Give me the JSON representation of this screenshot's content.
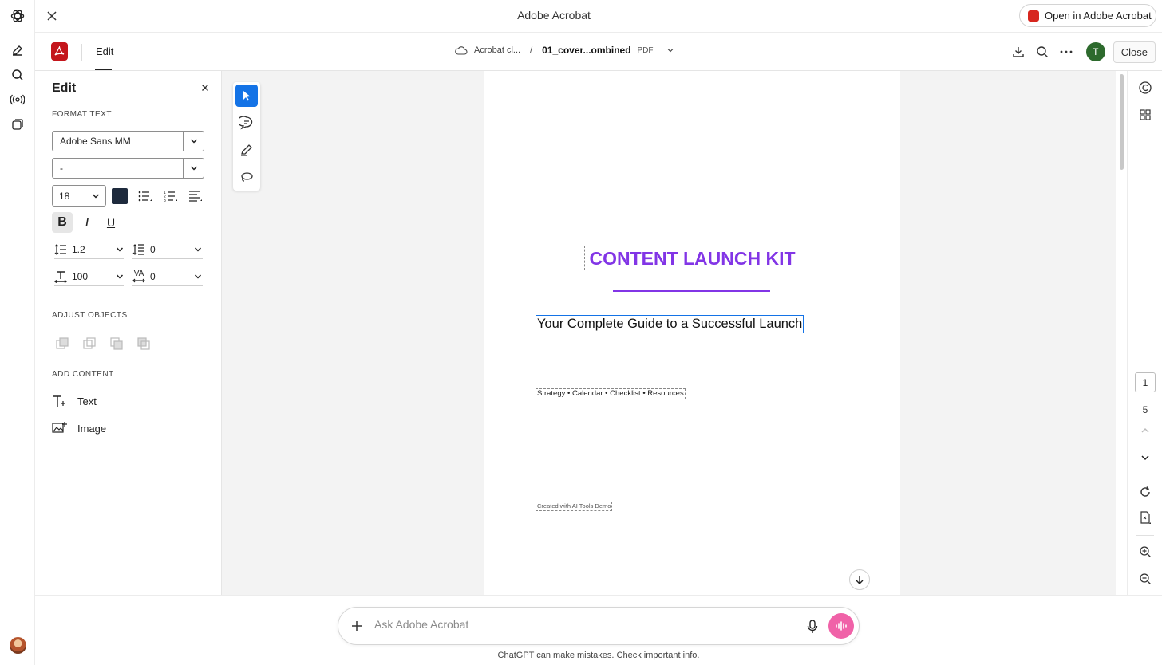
{
  "window": {
    "title": "Adobe Acrobat",
    "open_in_label": "Open in Adobe Acrobat"
  },
  "toolbar": {
    "edit_tab": "Edit",
    "breadcrumb_root": "Acrobat cl...",
    "breadcrumb_sep": "/",
    "doc_name": "01_cover...ombined",
    "doc_ext": "PDF",
    "user_initial": "T",
    "close_label": "Close"
  },
  "edit_panel": {
    "title": "Edit",
    "format_text_label": "FORMAT TEXT",
    "font_family": "Adobe Sans MM",
    "font_style": "-",
    "font_size": "18",
    "text_color": "#1e2a3d",
    "bold": "B",
    "italic": "I",
    "underline": "U",
    "line_spacing": "1.2",
    "paragraph_spacing": "0",
    "horizontal_scale": "100",
    "char_spacing_label": "VA",
    "char_spacing": "0",
    "adjust_objects_label": "ADJUST OBJECTS",
    "add_content_label": "ADD CONTENT",
    "add_text": "Text",
    "add_image": "Image"
  },
  "document": {
    "title": "CONTENT LAUNCH KIT",
    "subtitle": "Your Complete Guide to a Successful Launch",
    "tags": "Strategy • Calendar • Checklist • Resources",
    "credit": "Created with AI Tools Demo",
    "accent_color": "#8235e6"
  },
  "page_nav": {
    "current": "1",
    "total": "5"
  },
  "chat": {
    "placeholder": "Ask Adobe Acrobat",
    "disclaimer": "ChatGPT can make mistakes. Check important info."
  },
  "colors": {
    "brand_red": "#c4161c",
    "selection_blue": "#1473e6",
    "voice_pink": "#f062a8"
  }
}
